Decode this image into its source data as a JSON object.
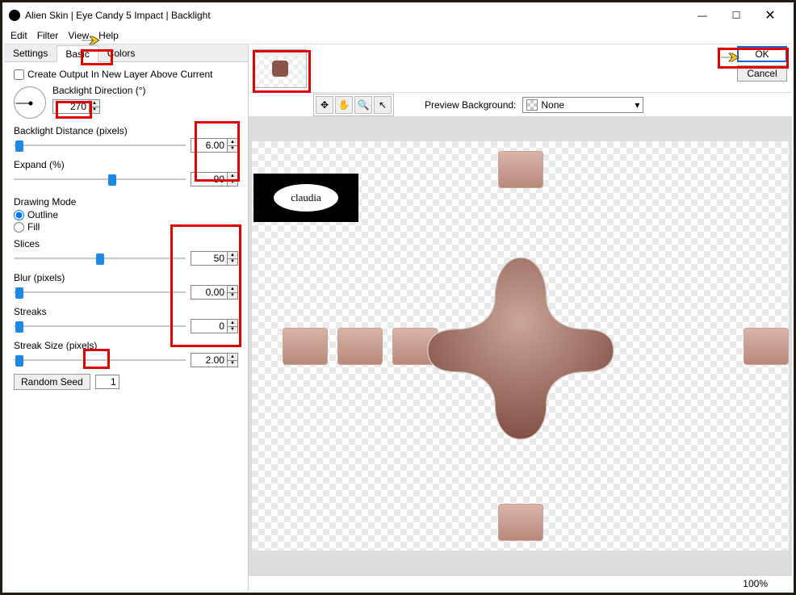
{
  "window": {
    "title": "Alien Skin | Eye Candy 5 Impact | Backlight",
    "buttons": {
      "min": "—",
      "max": "☐",
      "close": "✕"
    }
  },
  "menu": [
    "Edit",
    "Filter",
    "View",
    "Help"
  ],
  "tabs": {
    "settings": "Settings",
    "basic": "Basic",
    "colors": "Colors"
  },
  "panel": {
    "createOutput": "Create Output In New Layer Above Current",
    "direction_label": "Backlight Direction (°)",
    "direction_value": "270",
    "distance_label": "Backlight Distance (pixels)",
    "distance_value": "6.00",
    "expand_label": "Expand (%)",
    "expand_value": "90",
    "drawing_mode_label": "Drawing Mode",
    "outline_label": "Outline",
    "fill_label": "Fill",
    "slices_label": "Slices",
    "slices_value": "50",
    "blur_label": "Blur (pixels)",
    "blur_value": "0.00",
    "streaks_label": "Streaks",
    "streaks_value": "0",
    "streaksize_label": "Streak Size (pixels)",
    "streaksize_value": "2.00",
    "random_seed_btn": "Random Seed",
    "random_seed_value": "1"
  },
  "actions": {
    "ok": "OK",
    "cancel": "Cancel"
  },
  "preview_bg_label": "Preview Background:",
  "preview_bg_value": "None",
  "stamp_text": "claudia",
  "zoom": "100%",
  "icons": {
    "nav": "✥",
    "hand": "✋",
    "zoom": "🔍",
    "pointer": "↖"
  }
}
